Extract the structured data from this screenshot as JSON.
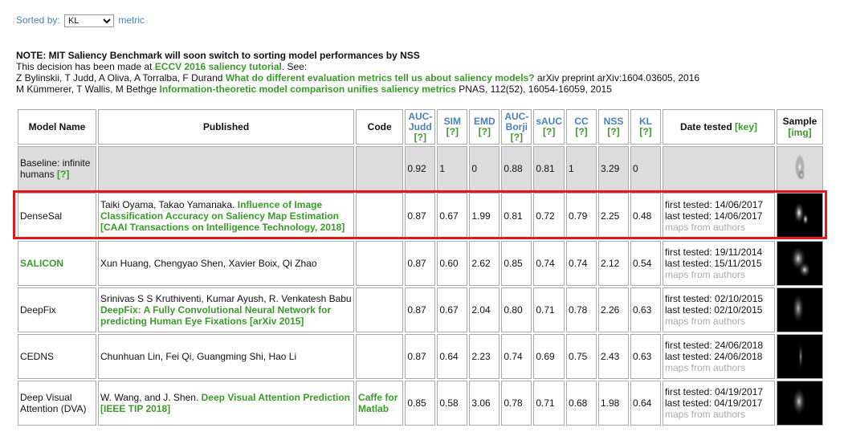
{
  "sort": {
    "label": "Sorted by:",
    "selected": "KL",
    "suffix": "metric"
  },
  "note": {
    "heading": "NOTE: MIT Saliency Benchmark will soon switch to sorting model performances by NSS",
    "line1_prefix": "This decision has been made at",
    "line1_link": "ECCV 2016 saliency tutorial",
    "line1_suffix": ". See:",
    "line2_authors": "Z Bylinskii, T Judd, A Oliva, A Torralba, F Durand",
    "line2_link": "What do different evaluation metrics tell us about saliency models?",
    "line2_suffix": "arXiv preprint arXiv:1604.03605, 2016",
    "line3_authors": "M Kümmerer, T Wallis, M Bethge",
    "line3_link": "Information-theoretic model comparison unifies saliency metrics",
    "line3_suffix": "PNAS, 112(52), 16054-16059, 2015"
  },
  "headers": {
    "model": "Model Name",
    "published": "Published",
    "code": "Code",
    "auc_judd": "AUC-Judd",
    "sim": "SIM",
    "emd": "EMD",
    "auc_borji": "AUC-Borji",
    "sauc": "sAUC",
    "cc": "CC",
    "nss": "NSS",
    "kl": "KL",
    "help": "[?]",
    "date": "Date tested",
    "key": "[key]",
    "sample": "Sample",
    "img": "[img]"
  },
  "rows": [
    {
      "name": "Baseline: infinite humans",
      "name_link": "[?]",
      "published_plain": "",
      "published_link": "",
      "code": "",
      "metrics": [
        "0.92",
        "1",
        "0",
        "0.88",
        "0.81",
        "1",
        "3.29",
        "0"
      ],
      "first": "",
      "last": "",
      "maps": ""
    },
    {
      "name": "DenseSal",
      "name_link": "",
      "published_plain": "Taiki Oyama, Takao Yamanaka.",
      "published_link": "Influence of Image Classification Accuracy on Saliency Map Estimation [CAAI Transactions on Intelligence Technology, 2018]",
      "code": "",
      "metrics": [
        "0.87",
        "0.67",
        "1.99",
        "0.81",
        "0.72",
        "0.79",
        "2.25",
        "0.48"
      ],
      "first": "first tested: 14/06/2017",
      "last": "last tested: 14/06/2017",
      "maps": "maps from authors"
    },
    {
      "name": "SALICON",
      "name_link": "",
      "published_plain": "Xun Huang, Chengyao Shen, Xavier Boix, Qi Zhao",
      "published_link": "",
      "code": "",
      "metrics": [
        "0.87",
        "0.60",
        "2.62",
        "0.85",
        "0.74",
        "0.74",
        "2.12",
        "0.54"
      ],
      "first": "first tested: 19/11/2014",
      "last": "last tested: 15/11/2015",
      "maps": "maps from authors"
    },
    {
      "name": "DeepFix",
      "name_link": "",
      "published_plain": "Srinivas S S Kruthiventi, Kumar Ayush, R. Venkatesh Babu",
      "published_link": "DeepFix: A Fully Convolutional Neural Network for predicting Human Eye Fixations [arXiv 2015]",
      "code": "",
      "metrics": [
        "0.87",
        "0.67",
        "2.04",
        "0.80",
        "0.71",
        "0.78",
        "2.26",
        "0.63"
      ],
      "first": "first tested: 02/10/2015",
      "last": "last tested: 02/10/2015",
      "maps": "maps from authors"
    },
    {
      "name": "CEDNS",
      "name_link": "",
      "published_plain": "Chunhuan Lin, Fei Qi, Guangming Shi, Hao Li",
      "published_link": "",
      "code": "",
      "metrics": [
        "0.87",
        "0.64",
        "2.23",
        "0.74",
        "0.69",
        "0.75",
        "2.43",
        "0.63"
      ],
      "first": "first tested: 24/06/2018",
      "last": "last tested: 24/06/2018",
      "maps": "maps from authors"
    },
    {
      "name": "Deep Visual Attention (DVA)",
      "name_link": "",
      "published_plain": "W. Wang, and J. Shen.",
      "published_link": "Deep Visual Attention Prediction [IEEE TIP 2018]",
      "code": "Caffe for Matlab",
      "metrics": [
        "0.85",
        "0.58",
        "3.06",
        "0.78",
        "0.71",
        "0.68",
        "1.98",
        "0.64"
      ],
      "first": "first tested: 04/19/2017",
      "last": "last tested: 04/19/2017",
      "maps": "maps from authors"
    }
  ]
}
